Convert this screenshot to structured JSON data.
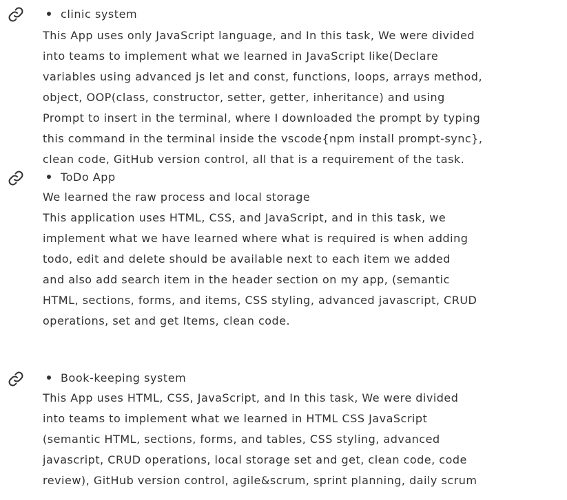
{
  "projects": [
    {
      "icon": "link-icon",
      "title": "clinic system",
      "lines": [
        "This App uses only JavaScript language, and In this task, We were divided",
        "into teams to implement what we learned in JavaScript like(Declare",
        "variables using advanced js let and const, functions, loops, arrays method,",
        "object, OOP(class, constructor, setter, getter, inheritance) and using",
        "Prompt to insert in the terminal, where I downloaded the prompt by typing",
        "this command in the terminal inside the vscode{npm install prompt-sync},",
        "clean code, GitHub version control, all that is a requirement of the task."
      ]
    },
    {
      "icon": "link-icon",
      "title": "ToDo App",
      "lines": [
        "We learned the raw process and local storage",
        "This application uses HTML, CSS, and JavaScript, and in this task, we",
        "implement what we have learned where what is required is when adding",
        "todo, edit and delete should be available next to each item we added",
        "and also add search item in the header section on my app, (semantic",
        "HTML, sections, forms, and items, CSS styling, advanced javascript, CRUD",
        "operations, set and get Items, clean code."
      ]
    },
    {
      "icon": "link-icon",
      "title": "Book-keeping system",
      "lines": [
        "This App uses HTML, CSS, JavaScript, and In this task, We were divided",
        "into teams to implement what we learned in HTML CSS JavaScript",
        "(semantic HTML, sections, forms, and tables, CSS styling, advanced",
        "javascript, CRUD operations, local storage set and get, clean code, code",
        "review), GitHub version control, agile&scrum, sprint planning, daily scrum"
      ]
    }
  ]
}
